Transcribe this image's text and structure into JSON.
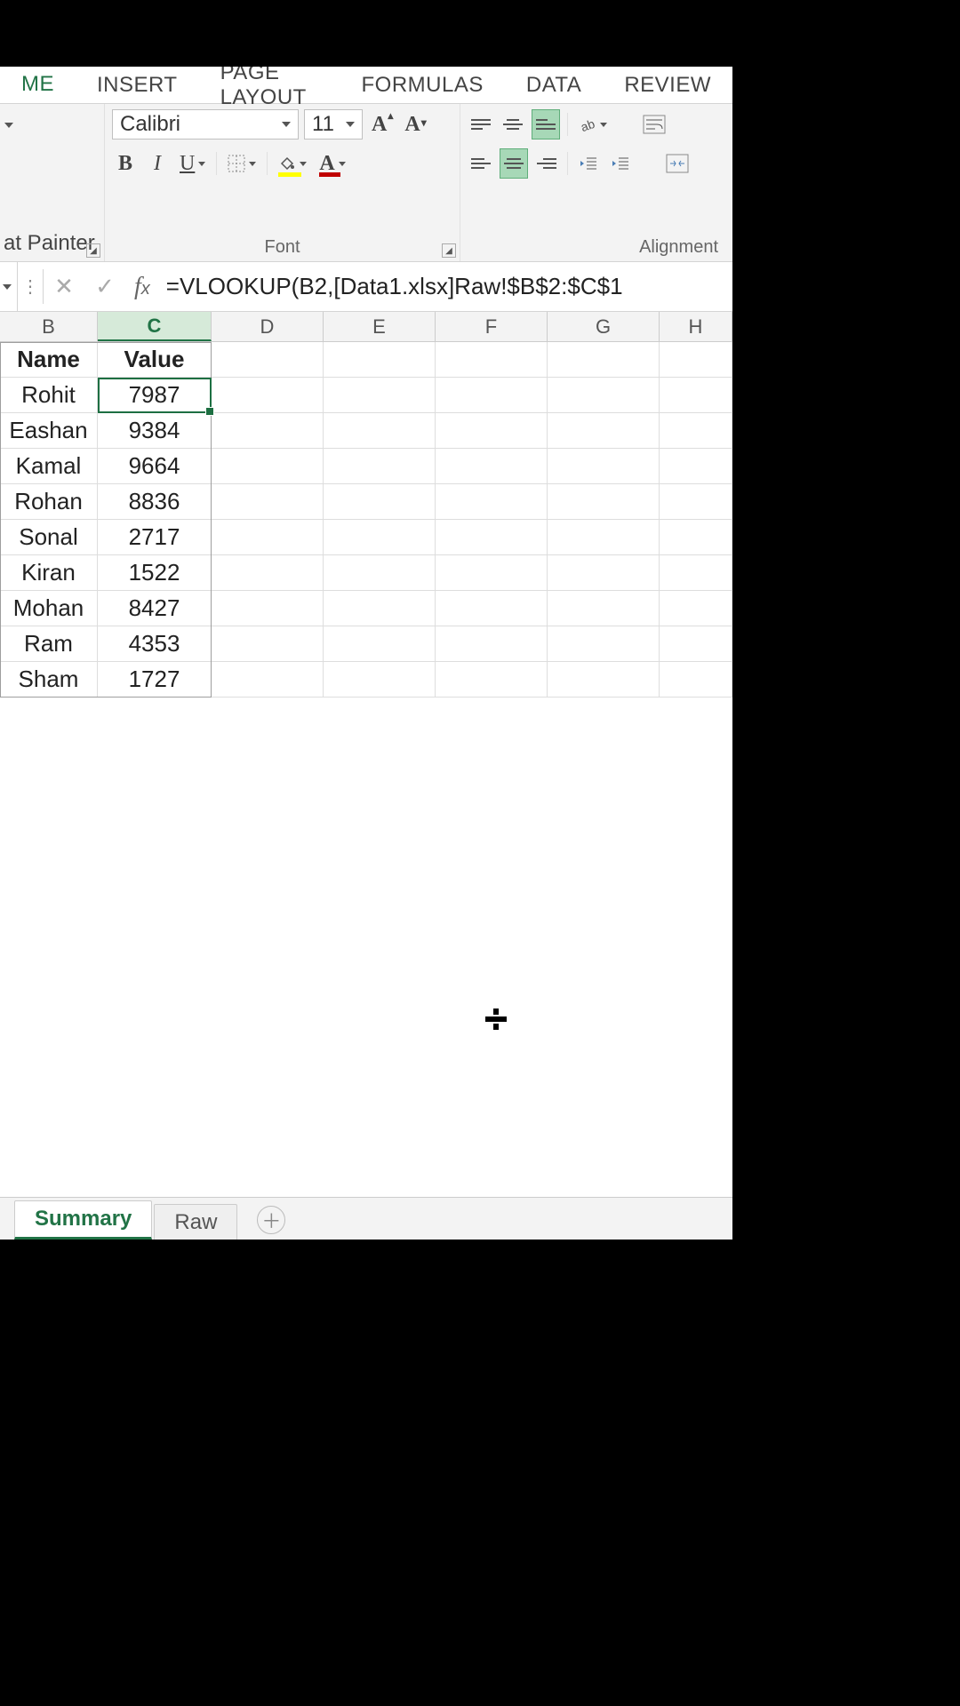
{
  "ribbon": {
    "tabs": [
      "ME",
      "INSERT",
      "PAGE LAYOUT",
      "FORMULAS",
      "DATA",
      "REVIEW"
    ],
    "active_tab": 0,
    "font_name": "Calibri",
    "font_size": "11",
    "clipboard_label": "at Painter",
    "group_font_label": "Font",
    "group_align_label": "Alignment"
  },
  "formula_bar": {
    "formula": "=VLOOKUP(B2,[Data1.xlsx]Raw!$B$2:$C$1"
  },
  "columns": [
    "B",
    "C",
    "D",
    "E",
    "F",
    "G",
    "H"
  ],
  "selected_column": "C",
  "table": {
    "headers": {
      "name": "Name",
      "value": "Value"
    },
    "rows": [
      {
        "name": "Rohit",
        "value": "7987"
      },
      {
        "name": "Eashan",
        "value": "9384"
      },
      {
        "name": "Kamal",
        "value": "9664"
      },
      {
        "name": "Rohan",
        "value": "8836"
      },
      {
        "name": "Sonal",
        "value": "2717"
      },
      {
        "name": "Kiran",
        "value": "1522"
      },
      {
        "name": "Mohan",
        "value": "8427"
      },
      {
        "name": "Ram",
        "value": "4353"
      },
      {
        "name": "Sham",
        "value": "1727"
      }
    ]
  },
  "selected_cell_value": "7987",
  "sheets": {
    "active": "Summary",
    "other": "Raw"
  }
}
